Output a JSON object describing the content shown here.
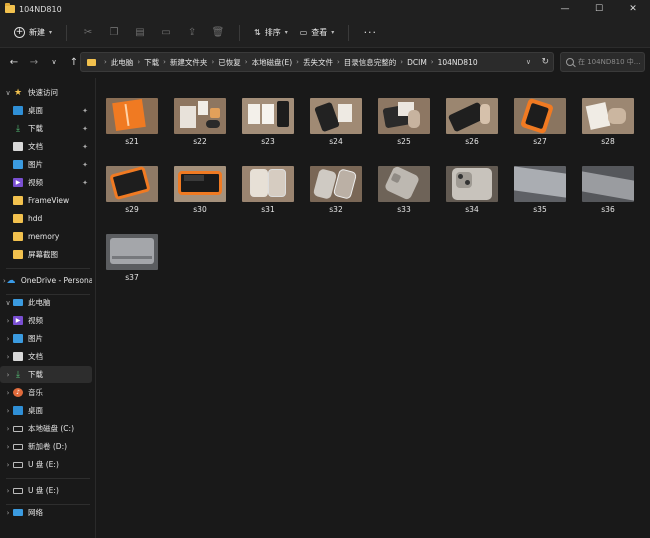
{
  "window": {
    "title": "104ND810",
    "controls": [
      "—",
      "☐",
      "✕"
    ]
  },
  "toolbar": {
    "new_label": "新建",
    "sort_label": "排序",
    "view_label": "查看",
    "more_label": "···"
  },
  "address": {
    "crumbs": [
      "此电脑",
      "下载",
      "新建文件夹",
      "已恢复",
      "本地磁盘(E)",
      "丢失文件",
      "目录信息完整的",
      "DCIM",
      "104ND810"
    ]
  },
  "search": {
    "placeholder": "在 104ND810 中..."
  },
  "sidebar": {
    "quick_access": "快速访问",
    "quick_items": [
      "桌面",
      "下载",
      "文档",
      "图片",
      "视频",
      "FrameView",
      "hdd",
      "memory",
      "屏幕截图"
    ],
    "onedrive": "OneDrive - Persona",
    "this_pc": "此电脑",
    "pc_items": [
      "视频",
      "图片",
      "文档",
      "下载",
      "音乐",
      "桌面",
      "本地磁盘 (C:)",
      "新加卷 (D:)",
      "U 盘 (E:)"
    ],
    "usb": "U 盘 (E:)",
    "network": "网络"
  },
  "files": [
    "s21",
    "s22",
    "s23",
    "s24",
    "s25",
    "s26",
    "s27",
    "s28",
    "s29",
    "s30",
    "s31",
    "s32",
    "s33",
    "s34",
    "s35",
    "s36",
    "s37"
  ],
  "colors": {
    "background": "#191919",
    "chrome": "#202020",
    "folder": "#f2c14e",
    "accent": "#2f8fd6"
  }
}
